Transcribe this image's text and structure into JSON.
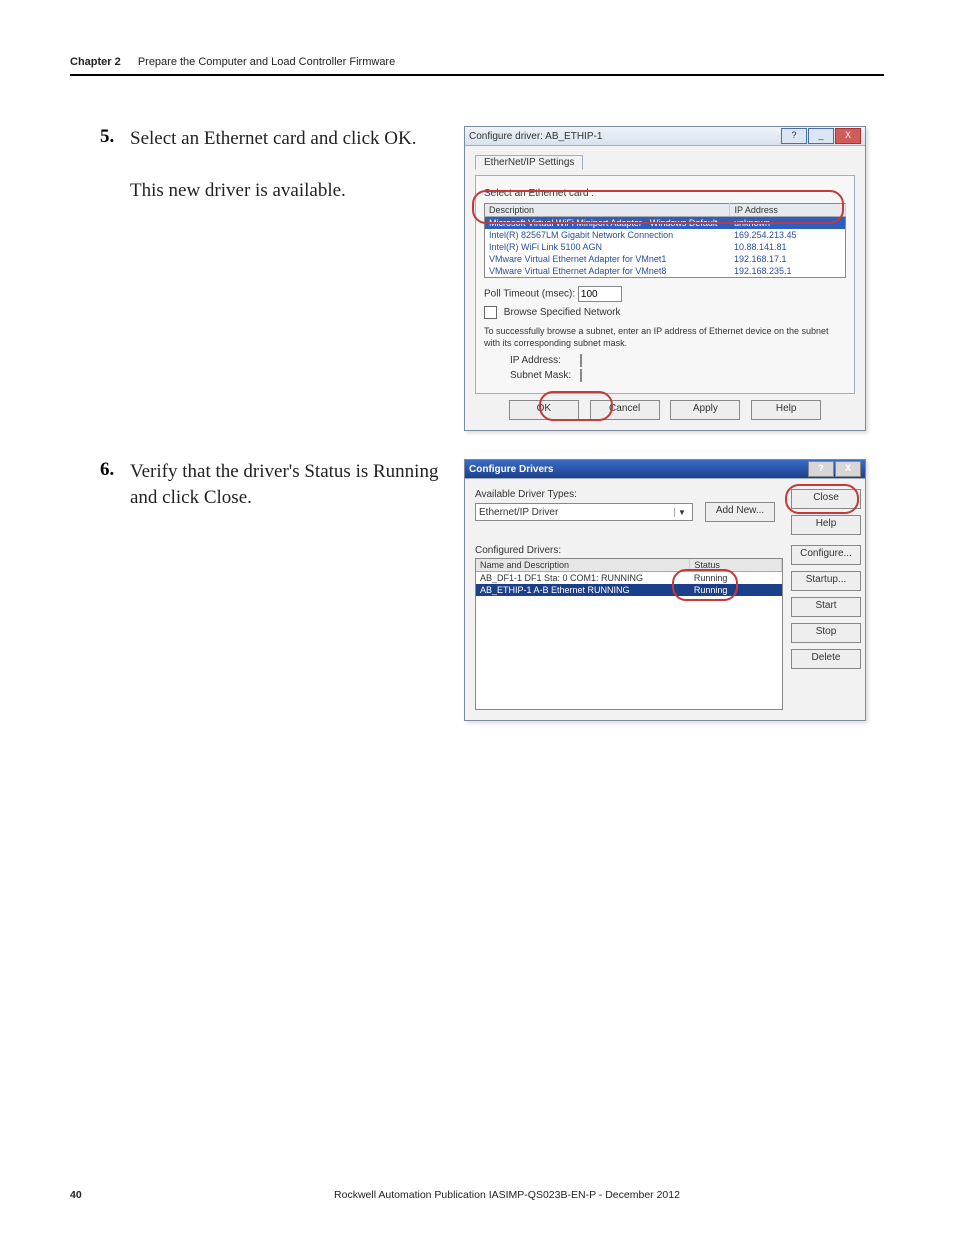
{
  "header": {
    "chapter": "Chapter 2",
    "title": "Prepare the Computer and Load Controller Firmware"
  },
  "steps": {
    "s5": {
      "num": "5.",
      "text": "Select an Ethernet card and click OK.",
      "sub": "This new driver is available."
    },
    "s6": {
      "num": "6.",
      "text": "Verify that the driver's Status is Running and click Close."
    }
  },
  "dlg1": {
    "title": "Configure driver: AB_ETHIP-1",
    "tab": "EtherNet/IP Settings",
    "select_label": "Select an Ethernet card :",
    "col_desc": "Description",
    "col_ip": "IP Address",
    "rows": [
      {
        "desc": "Microsoft Virtual WiFi Miniport Adapter - Windows Default",
        "ip": "unknown",
        "selected": true
      },
      {
        "desc": "Intel(R) 82567LM Gigabit Network Connection",
        "ip": "169.254.213.45"
      },
      {
        "desc": "Intel(R) WiFi Link 5100 AGN",
        "ip": "10.88.141.81"
      },
      {
        "desc": "VMware Virtual Ethernet Adapter for VMnet1",
        "ip": "192.168.17.1"
      },
      {
        "desc": "VMware Virtual Ethernet Adapter for VMnet8",
        "ip": "192.168.235.1"
      }
    ],
    "poll_label": "Poll Timeout (msec):",
    "poll_value": "100",
    "browse_label": "Browse Specified Network",
    "browse_note": "To successfully browse a subnet, enter an IP address of Ethernet device on the subnet with its corresponding subnet mask.",
    "ip_label": "IP Address:",
    "mask_label": "Subnet Mask:",
    "btn_ok": "OK",
    "btn_cancel": "Cancel",
    "btn_apply": "Apply",
    "btn_help": "Help"
  },
  "dlg2": {
    "title": "Configure Drivers",
    "avail_label": "Available Driver Types:",
    "avail_value": "Ethernet/IP Driver",
    "btn_addnew": "Add New...",
    "btn_close": "Close",
    "btn_help": "Help",
    "conf_label": "Configured Drivers:",
    "col_name": "Name and Description",
    "col_status": "Status",
    "rows": [
      {
        "name": "AB_DF1-1 DF1 Sta: 0 COM1: RUNNING",
        "status": "Running"
      },
      {
        "name": "AB_ETHIP-1  A-B Ethernet  RUNNING",
        "status": "Running",
        "selected": true
      }
    ],
    "btn_configure": "Configure...",
    "btn_startup": "Startup...",
    "btn_start": "Start",
    "btn_stop": "Stop",
    "btn_delete": "Delete"
  },
  "footer": {
    "page": "40",
    "pub": "Rockwell Automation Publication IASIMP-QS023B-EN-P - December 2012"
  },
  "icons": {
    "help": "?",
    "close_x": "X",
    "min": "_",
    "dropdown": "▼"
  },
  "colors": {
    "highlight": "#c23a3a",
    "selection": "#2b5fc2",
    "titlebar2": "#1c3f8a"
  }
}
